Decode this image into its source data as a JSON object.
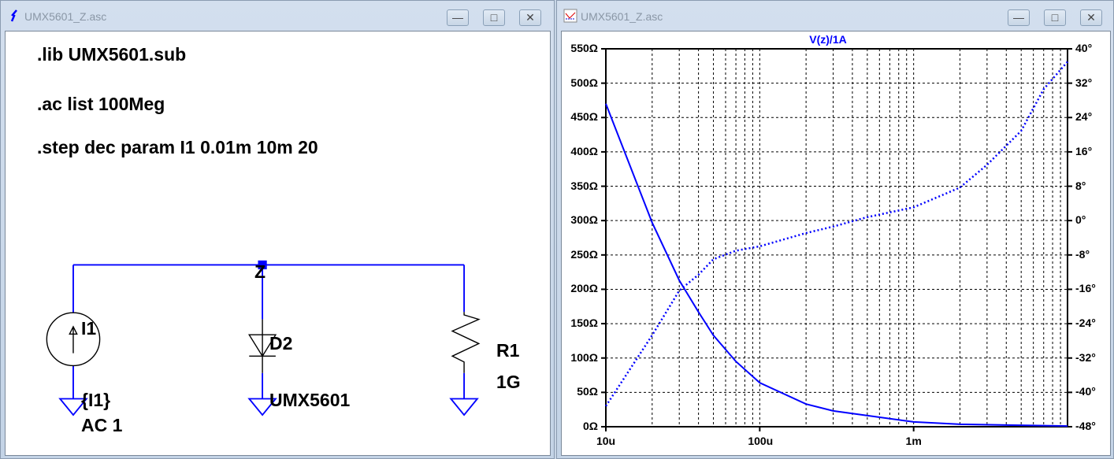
{
  "schematic_window": {
    "title": "UMX5601_Z.asc",
    "buttons": {
      "minimize": "—",
      "maximize": "□",
      "close": "✕"
    },
    "directives": [
      ".lib UMX5601.sub",
      ".ac list 100Meg",
      ".step dec param I1 0.01m 10m 20"
    ],
    "net_label": "Z",
    "components": {
      "source": {
        "name": "I1",
        "value": "{I1}",
        "ac": "AC 1"
      },
      "diode": {
        "name": "D2",
        "model": "UMX5601"
      },
      "resistor": {
        "name": "R1",
        "value": "1G"
      }
    },
    "wire_color": "#0000ff"
  },
  "plot_window": {
    "title": "UMX5601_Z.asc",
    "buttons": {
      "minimize": "—",
      "maximize": "□",
      "close": "✕"
    }
  },
  "chart_data": {
    "type": "line",
    "title": "V(z)/1A",
    "x_scale": "log",
    "xlim": [
      1e-05,
      0.01
    ],
    "x_ticks": [
      "10u",
      "100u",
      "1m"
    ],
    "y_left": {
      "ylim": [
        0,
        550
      ],
      "ticks": [
        "0Ω",
        "50Ω",
        "100Ω",
        "150Ω",
        "200Ω",
        "250Ω",
        "300Ω",
        "350Ω",
        "400Ω",
        "450Ω",
        "500Ω",
        "550Ω"
      ]
    },
    "y_right": {
      "ylim": [
        -48,
        40
      ],
      "ticks": [
        "-48°",
        "-40°",
        "-32°",
        "-24°",
        "-16°",
        "-8°",
        "0°",
        "8°",
        "16°",
        "24°",
        "32°",
        "40°"
      ]
    },
    "grid": true,
    "series": [
      {
        "name": "magnitude",
        "axis": "left",
        "style": "solid",
        "color": "#0000ff",
        "x": [
          1e-05,
          2e-05,
          3e-05,
          4e-05,
          5e-05,
          7e-05,
          0.0001,
          0.0002,
          0.0003,
          0.001,
          0.002,
          0.01
        ],
        "y": [
          470,
          297,
          213,
          167,
          133,
          95,
          64,
          33,
          23,
          7,
          3.5,
          1
        ]
      },
      {
        "name": "phase",
        "axis": "right",
        "style": "dotted",
        "color": "#0000ff",
        "x": [
          1e-05,
          2e-05,
          3e-05,
          4e-05,
          5e-05,
          7e-05,
          0.0001,
          0.0002,
          0.0003,
          0.0005,
          0.001,
          0.002,
          0.003,
          0.005,
          0.007,
          0.01
        ],
        "y": [
          -43.2,
          -26.7,
          -16.3,
          -12.6,
          -9,
          -7,
          -6,
          -2.9,
          -1.4,
          0.8,
          3.1,
          7.7,
          13,
          20.9,
          30.6,
          37
        ]
      }
    ]
  }
}
